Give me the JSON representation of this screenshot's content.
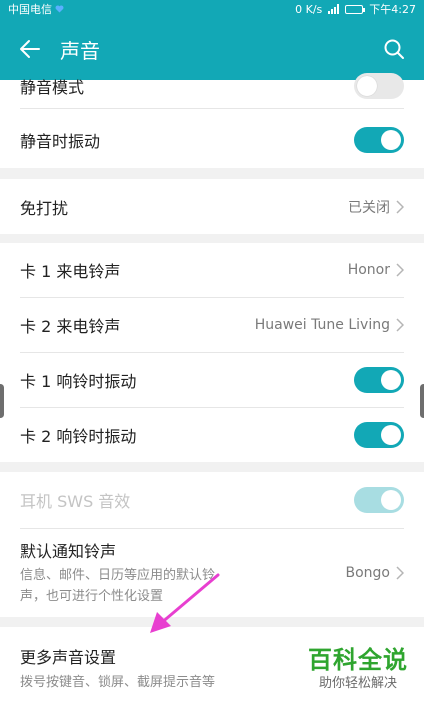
{
  "status_bar": {
    "carrier": "中国电信",
    "network_speed": "0 K/s",
    "time": "下午4:27",
    "icons": [
      "heart-icon",
      "signal-icon",
      "battery-icon"
    ]
  },
  "app_bar": {
    "title": "声音",
    "back_icon": "arrow-left-icon",
    "search_icon": "search-icon"
  },
  "colors": {
    "accent": "#12a8b6",
    "toggle_off": "#e8e8e8",
    "toggle_disabled": "#a8dde2",
    "annotation": "#e83fd0",
    "watermark": "#2fa52f"
  },
  "settings": {
    "silent_mode": {
      "label": "静音模式",
      "enabled": false
    },
    "vibrate_when_silent": {
      "label": "静音时振动",
      "enabled": true
    },
    "do_not_disturb": {
      "label": "免打扰",
      "value": "已关闭"
    },
    "sim1_ringtone": {
      "label": "卡 1 来电铃声",
      "value": "Honor"
    },
    "sim2_ringtone": {
      "label": "卡 2 来电铃声",
      "value": "Huawei Tune Living"
    },
    "sim1_vibrate": {
      "label": "卡 1 响铃时振动",
      "enabled": true
    },
    "sim2_vibrate": {
      "label": "卡 2 响铃时振动",
      "enabled": true
    },
    "earphone_sws": {
      "label": "耳机 SWS 音效",
      "enabled": true,
      "disabled": true
    },
    "default_notification": {
      "label": "默认通知铃声",
      "description_line1": "信息、邮件、日历等应用的默认铃",
      "description_line2": "声，也可进行个性化设置",
      "value": "Bongo"
    },
    "more_sound_settings": {
      "label": "更多声音设置",
      "description": "拨号按键音、锁屏、截屏提示音等"
    }
  },
  "watermark": {
    "main": "百科全说",
    "sub": "助你轻松解决"
  }
}
